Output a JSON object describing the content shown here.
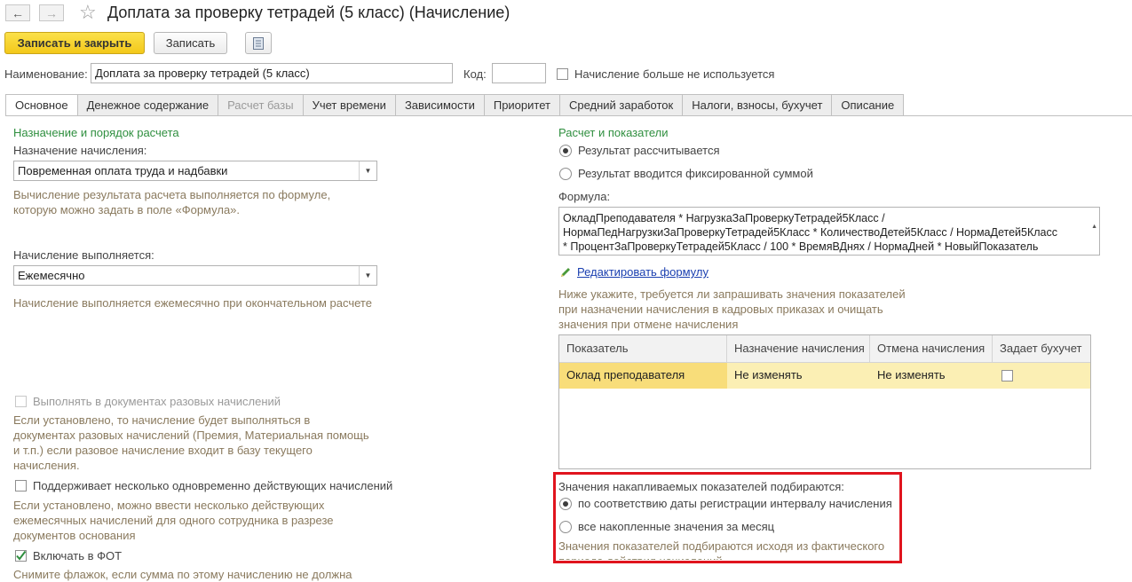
{
  "window": {
    "title": "Доплата за проверку тетрадей (5 класс) (Начисление)",
    "back_icon": "arrow-left-icon",
    "forward_icon": "arrow-right-icon",
    "favorite_icon": "star-icon"
  },
  "toolbar": {
    "save_close_label": "Записать и закрыть",
    "save_label": "Записать",
    "report_icon": "document-list-icon"
  },
  "header": {
    "name_label": "Наименование:",
    "name_value": "Доплата за проверку тетрадей (5 класс)",
    "code_label": "Код:",
    "code_value": "",
    "unused_label": "Начисление больше не используется"
  },
  "tabs": [
    {
      "label": "Основное",
      "state": "active"
    },
    {
      "label": "Денежное содержание",
      "state": "normal"
    },
    {
      "label": "Расчет базы",
      "state": "disabled"
    },
    {
      "label": "Учет времени",
      "state": "normal"
    },
    {
      "label": "Зависимости",
      "state": "normal"
    },
    {
      "label": "Приоритет",
      "state": "normal"
    },
    {
      "label": "Средний заработок",
      "state": "normal"
    },
    {
      "label": "Налоги, взносы, бухучет",
      "state": "normal"
    },
    {
      "label": "Описание",
      "state": "normal"
    }
  ],
  "left": {
    "section_title": "Назначение и порядок расчета",
    "purpose_label": "Назначение начисления:",
    "purpose_value": "Повременная оплата труда и надбавки",
    "purpose_hint": "Вычисление результата расчета выполняется по формуле,\nкоторую можно задать в поле «Формула».",
    "execution_label": "Начисление выполняется:",
    "execution_value": "Ежемесячно",
    "execution_hint": "Начисление выполняется ежемесячно при окончательном расчете",
    "onetime_label": "Выполнять в документах разовых начислений",
    "onetime_hint": "Если установлено, то начисление будет выполняться в\nдокументах разовых начислений (Премия, Материальная помощь\nи т.п.) если разовое начисление входит в базу текущего\nначисления.",
    "multiple_label": "Поддерживает несколько одновременно действующих начислений",
    "multiple_hint": "Если установлено, можно ввести несколько действующих\nежемесячных начислений для одного сотрудника в разрезе\nдокументов основания",
    "fot_label": "Включать в ФОТ",
    "fot_hint": "Снимите флажок, если сумма по этому начислению не должна"
  },
  "right": {
    "section_title": "Расчет и показатели",
    "radio_calculated": "Результат рассчитывается",
    "radio_fixed": "Результат вводится фиксированной суммой",
    "formula_label": "Формула:",
    "formula_lines": [
      "ОкладПреподавателя * НагрузкаЗаПроверкуТетрадей5Класс /",
      "НормаПедНагрузкиЗаПроверкуТетрадей5Класс * КоличествоДетей5Класс / НормаДетей5Класс",
      "* ПроцентЗаПроверкуТетрадей5Класс / 100 * ВремяВДнях / НормаДней      *      НовыйПоказатель"
    ],
    "edit_formula_link": "Редактировать формулу",
    "edit_icon": "pencil-icon",
    "indicators_hint": "Ниже укажите, требуется ли запрашивать значения показателей\nпри назначении начисления в кадровых приказах и очищать\nзначения при отмене начисления",
    "table": {
      "columns": [
        "Показатель",
        "Назначение начисления",
        "Отмена начисления",
        "Задает бухучет"
      ],
      "rows": [
        {
          "indicator": "Оклад преподавателя",
          "assign": "Не изменять",
          "cancel": "Не изменять",
          "accounting": false
        }
      ]
    },
    "accum_title": "Значения накапливаемых показателей подбираются:",
    "accum_option1": "по соответствию даты регистрации интервалу начисления",
    "accum_option2": "все накопленные значения за месяц",
    "accum_hint": "Значения показателей подбираются исходя из фактического\nпериода действия начислений"
  }
}
